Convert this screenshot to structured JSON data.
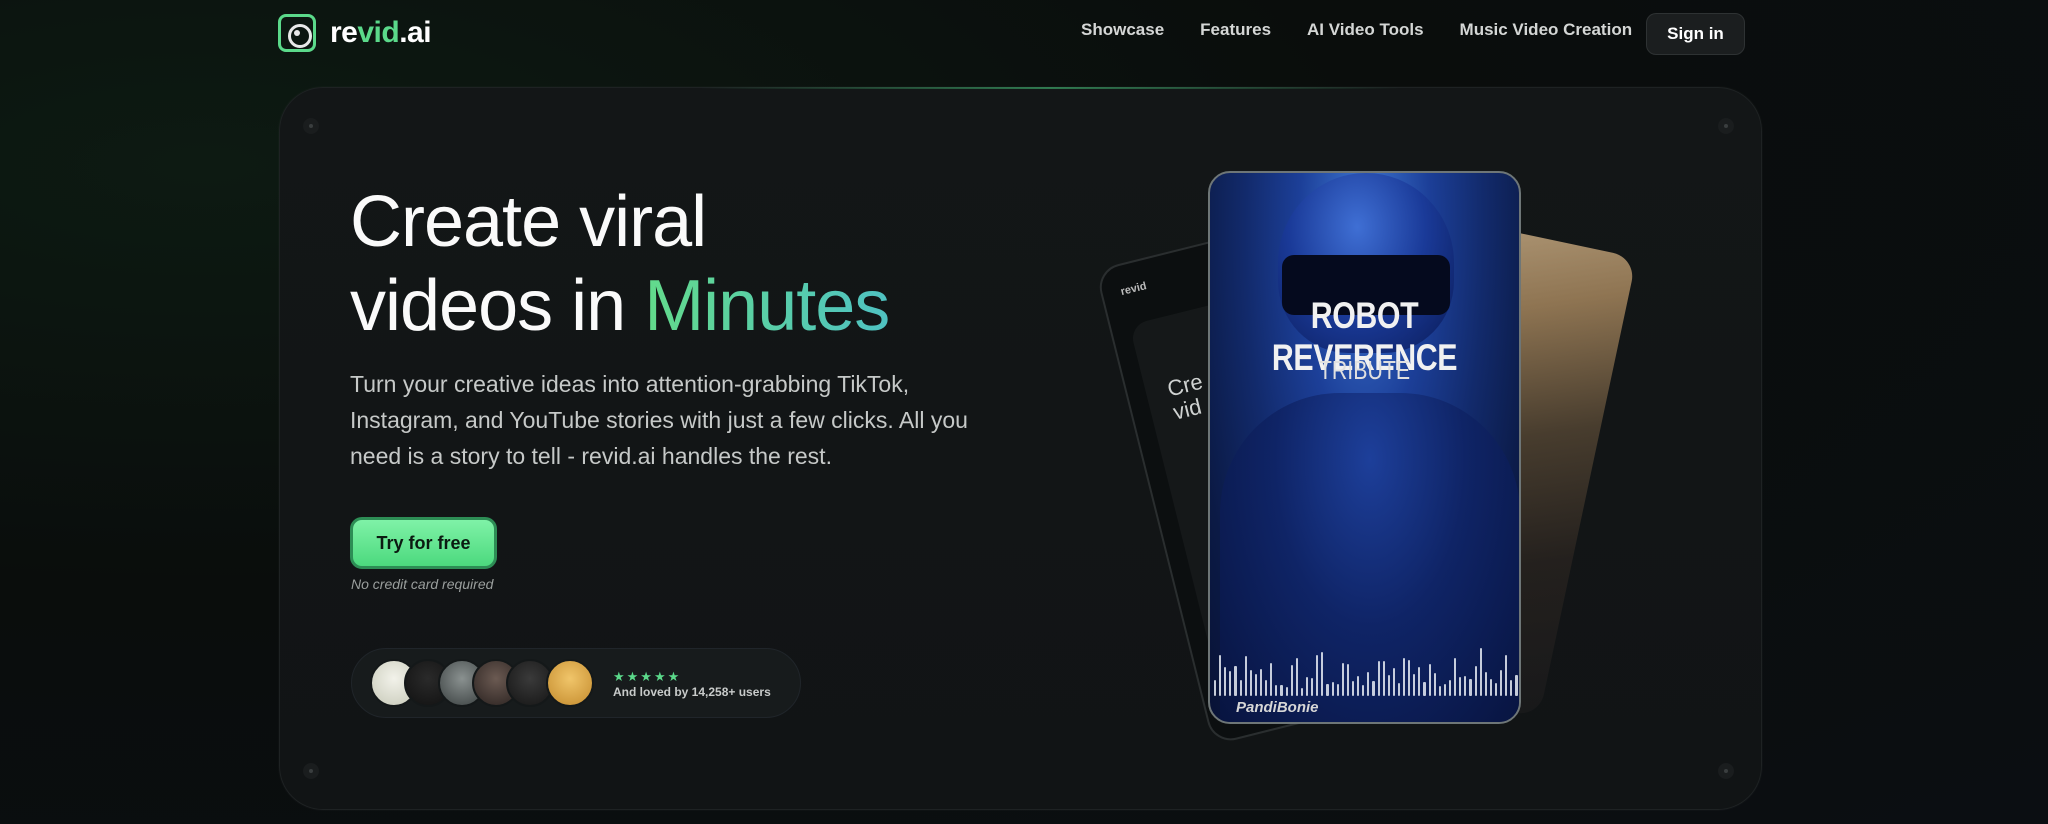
{
  "nav": {
    "logo": {
      "prefix": "re",
      "accent": "vid",
      "suffix": ".ai"
    },
    "links": [
      "Showcase",
      "Features",
      "AI Video Tools",
      "Music Video Creation"
    ],
    "signin_label": "Sign in"
  },
  "hero": {
    "headline_line1": "Create viral",
    "headline_line2_prefix": "videos in",
    "headline_accent": "Minutes",
    "subtitle": "Turn your creative ideas into attention-grabbing TikTok, Instagram, and YouTube stories with just a few clicks. All you need is a story to tell - revid.ai handles the rest.",
    "cta_label": "Try for free",
    "cta_note": "No credit card required",
    "social_proof": {
      "stars": "★★★★★",
      "text": "And loved by 14,258+ users",
      "avatar_count": 6
    }
  },
  "preview": {
    "front_title": "ROBOT REVERENCE",
    "front_subtitle": "TRIBUTE",
    "front_brand": "PandiBonie",
    "back_left_logo": "revid",
    "back_left_text": "Cre\nvid"
  },
  "colors": {
    "accent": "#5bd98a",
    "accent_cyan": "#4fc2c2",
    "background": "#0a0d0c",
    "card": "#131617"
  }
}
